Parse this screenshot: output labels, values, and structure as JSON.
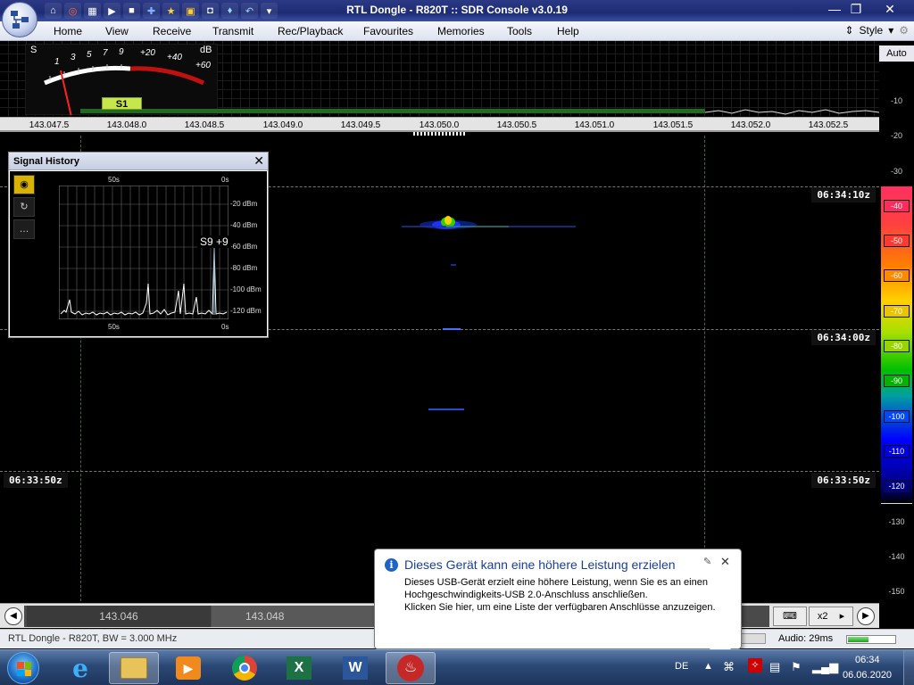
{
  "window": {
    "title": "RTL Dongle - R820T :: SDR Console v3.0.19"
  },
  "menu": {
    "items": [
      "Home",
      "View",
      "Receive",
      "Transmit",
      "Rec/Playback",
      "Favourites",
      "Memories",
      "Tools",
      "Help"
    ],
    "style_label": "Style"
  },
  "smeter": {
    "s_label": "S",
    "db_label": "dB",
    "scale": [
      "1",
      "3",
      "5",
      "7",
      "9",
      "+20",
      "+40",
      "+60"
    ],
    "reading": "S1"
  },
  "dbscale": {
    "auto_label": "Auto",
    "plain_labels": [
      "-10",
      "-20",
      "-30"
    ],
    "bottom_labels": [
      "-130",
      "-140",
      "-150"
    ],
    "color_boxes": [
      {
        "label": "-40",
        "color": "#ff2b5e"
      },
      {
        "label": "-50",
        "color": "#ff3b30"
      },
      {
        "label": "-60",
        "color": "#ff8a00"
      },
      {
        "label": "-70",
        "color": "#e9c400"
      },
      {
        "label": "-80",
        "color": "#9ad400"
      },
      {
        "label": "-90",
        "color": "#00b400"
      },
      {
        "label": "-100",
        "color": "#0048ff"
      },
      {
        "label": "-110",
        "color": "#0000e0"
      },
      {
        "label": "-120",
        "color": "#000088"
      }
    ]
  },
  "freq_axis": [
    "143.047.5",
    "143.048.0",
    "143.048.5",
    "143.049.0",
    "143.049.5",
    "143.050.0",
    "143.050.5",
    "143.051.0",
    "143.051.5",
    "143.052.0",
    "143.052.5"
  ],
  "waterfall": {
    "times": [
      "06:34:10z",
      "06:34:00z",
      "06:33:50z"
    ],
    "left_time": "06:33:50z"
  },
  "signal_history": {
    "title": "Signal History",
    "top_labels": [
      "50s",
      "0s"
    ],
    "bottom_labels": [
      "50s",
      "0s"
    ],
    "y_labels": [
      "-20 dBm",
      "-40 dBm",
      "-60 dBm",
      "-80 dBm",
      "-100 dBm",
      "-120 dBm"
    ],
    "reading": "S9 +9"
  },
  "scroller": {
    "freq1": "143.046",
    "freq2": "143.048",
    "zoom": "x2"
  },
  "status": {
    "left": "RTL Dongle - R820T, BW = 3.000 MHz",
    "audio": "Audio: 29ms",
    "audio_level": 0.45
  },
  "notification": {
    "title": "Dieses Gerät kann eine höhere Leistung erzielen",
    "body": "Dieses USB-Gerät erzielt eine höhere Leistung, wenn Sie es an einen Hochgeschwindigkeits-USB 2.0-Anschluss anschließen.",
    "body2": "Klicken Sie hier, um eine Liste der verfügbaren Anschlüsse anzuzeigen."
  },
  "taskbar": {
    "lang": "DE",
    "time": "06:34",
    "date": "06.06.2020"
  }
}
